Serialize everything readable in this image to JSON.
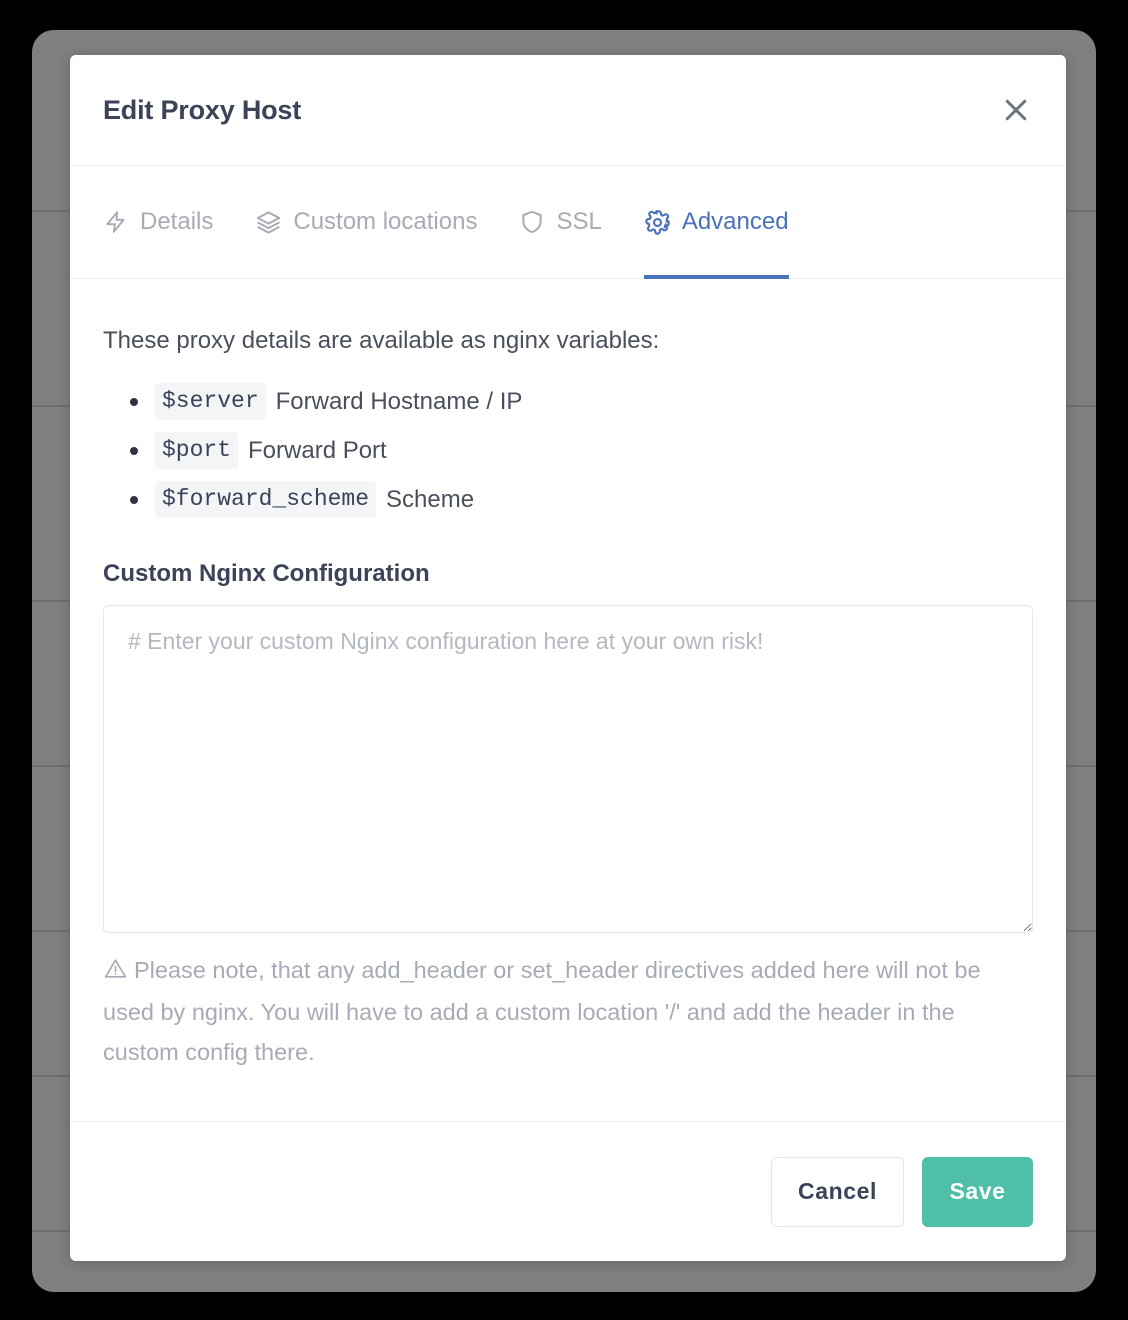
{
  "modal": {
    "title": "Edit Proxy Host",
    "close_icon": "close-icon"
  },
  "tabs": [
    {
      "label": "Details",
      "icon": "lightning-bolt-icon",
      "active": false
    },
    {
      "label": "Custom locations",
      "icon": "layers-icon",
      "active": false
    },
    {
      "label": "SSL",
      "icon": "shield-icon",
      "active": false
    },
    {
      "label": "Advanced",
      "icon": "gear-icon",
      "active": true
    }
  ],
  "body": {
    "intro": "These proxy details are available as nginx variables:",
    "variables": [
      {
        "code": "$server",
        "description": "Forward Hostname / IP"
      },
      {
        "code": "$port",
        "description": "Forward Port"
      },
      {
        "code": "$forward_scheme",
        "description": "Scheme"
      }
    ],
    "config_label": "Custom Nginx Configuration",
    "config_value": "",
    "config_placeholder": "# Enter your custom Nginx configuration here at your own risk!",
    "note_icon": "warning-triangle-icon",
    "note": "Please note, that any add_header or set_header directives added here will not be used by nginx. You will have to add a custom location '/' and add the header in the custom config there."
  },
  "footer": {
    "cancel_label": "Cancel",
    "save_label": "Save"
  },
  "colors": {
    "accent_blue": "#4a72b8",
    "save_teal": "#4fbfa8",
    "muted_text": "#a7abb5",
    "heading_text": "#3c4257",
    "chip_bg": "#f4f5f7",
    "backdrop_gray": "#808080"
  }
}
